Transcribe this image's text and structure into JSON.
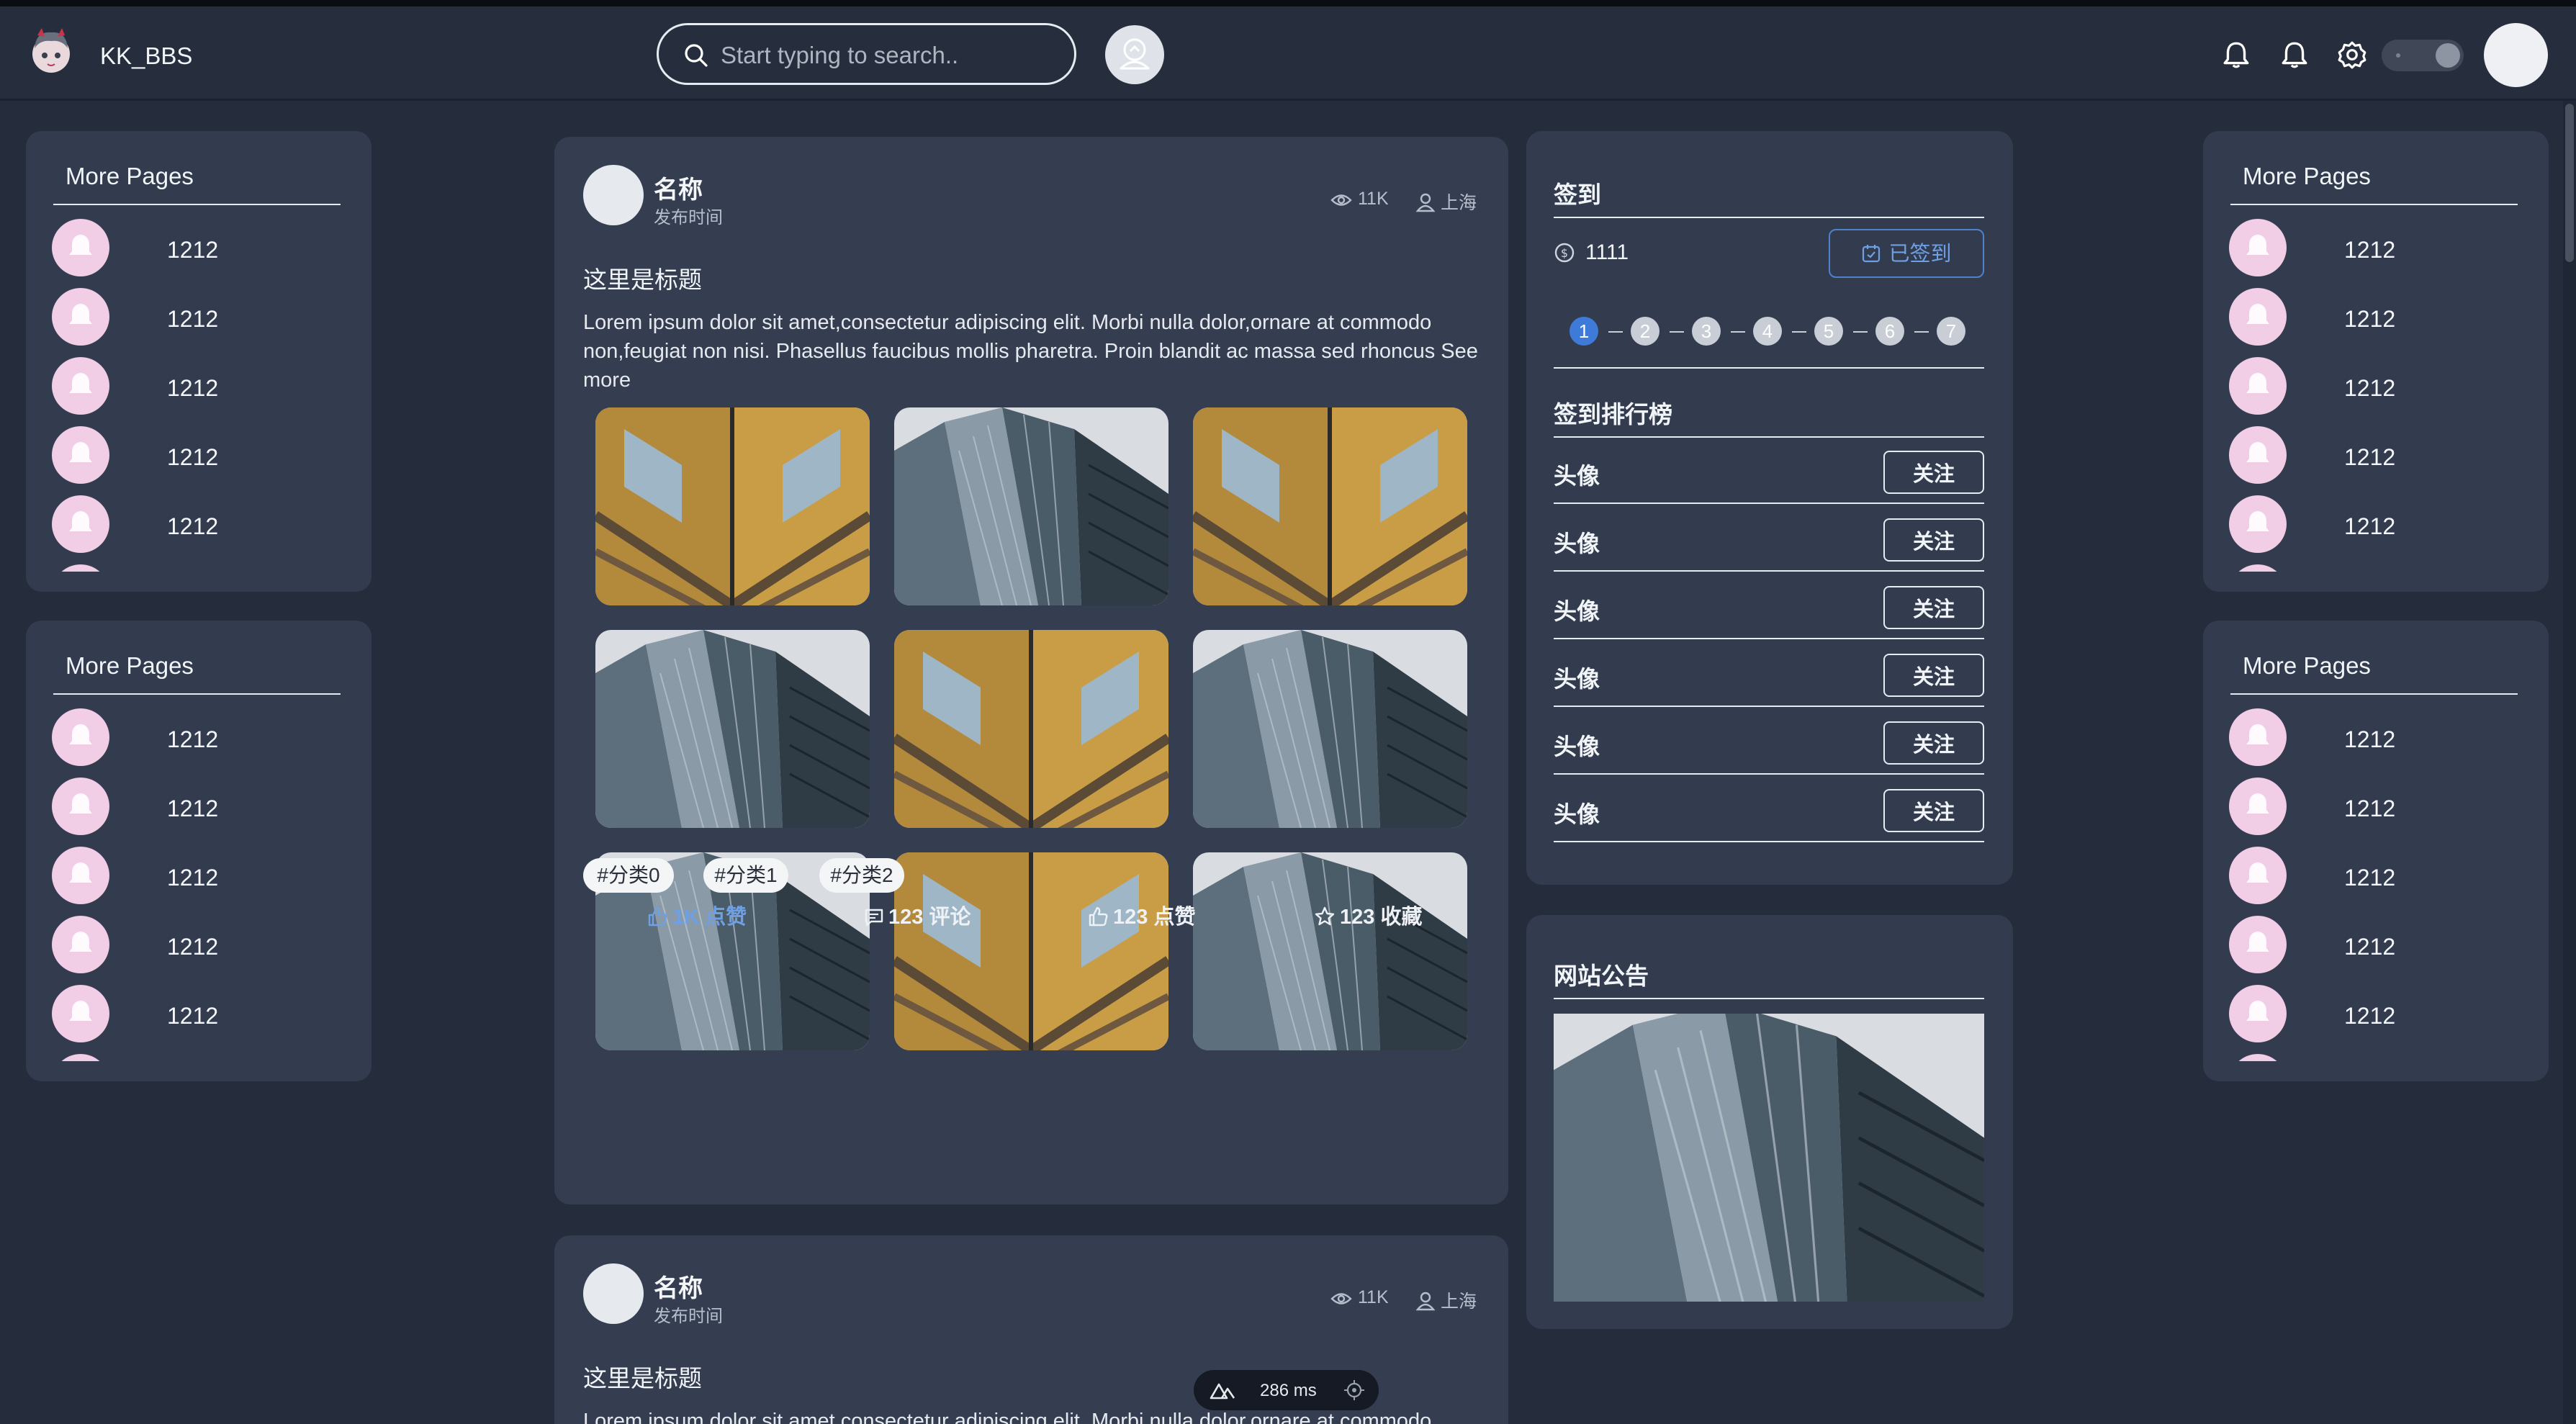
{
  "app": {
    "title": "KK_BBS"
  },
  "search": {
    "placeholder": "Start typing to search.."
  },
  "header_icons": [
    "bell-icon",
    "bell-icon",
    "gear-icon",
    "theme-toggle"
  ],
  "side_panels": {
    "title": "More Pages",
    "items": [
      "1212",
      "1212",
      "1212",
      "1212",
      "1212"
    ]
  },
  "posts": [
    {
      "name": "名称",
      "time": "发布时间",
      "views": "11K",
      "location": "上海",
      "title": "这里是标题",
      "body": "Lorem ipsum dolor sit amet,consectetur adipiscing elit. Morbi nulla dolor,ornare at commodo non,feugiat non nisi. Phasellus faucibus mollis pharetra. Proin blandit ac massa sed rhoncus See more",
      "tags": [
        "#分类0",
        "#分类1",
        "#分类2"
      ],
      "actions": {
        "like_active": "1K 点赞",
        "comment": "123 评论",
        "like": "123 点赞",
        "favorite": "123 收藏"
      }
    },
    {
      "name": "名称",
      "time": "发布时间",
      "views": "11K",
      "location": "上海",
      "title": "这里是标题",
      "body": "Lorem ipsum dolor sit amet,consectetur adipiscing elit. Morbi nulla dolor,ornare at commodo"
    }
  ],
  "checkin": {
    "title": "签到",
    "coins": "1111",
    "signed_label": "已签到",
    "days": [
      "1",
      "2",
      "3",
      "4",
      "5",
      "6",
      "7"
    ],
    "current_day": 1,
    "rank_title": "签到排行榜",
    "rank": [
      {
        "name": "头像",
        "button": "关注"
      },
      {
        "name": "头像",
        "button": "关注"
      },
      {
        "name": "头像",
        "button": "关注"
      },
      {
        "name": "头像",
        "button": "关注"
      },
      {
        "name": "头像",
        "button": "关注"
      },
      {
        "name": "头像",
        "button": "关注"
      }
    ]
  },
  "notice": {
    "title": "网站公告"
  },
  "perf": {
    "label": "286 ms"
  },
  "colors": {
    "background": "#252d3d",
    "panel": "#333c4e",
    "accent": "#3e7bd9",
    "avatar_pink": "#f1cde6"
  }
}
